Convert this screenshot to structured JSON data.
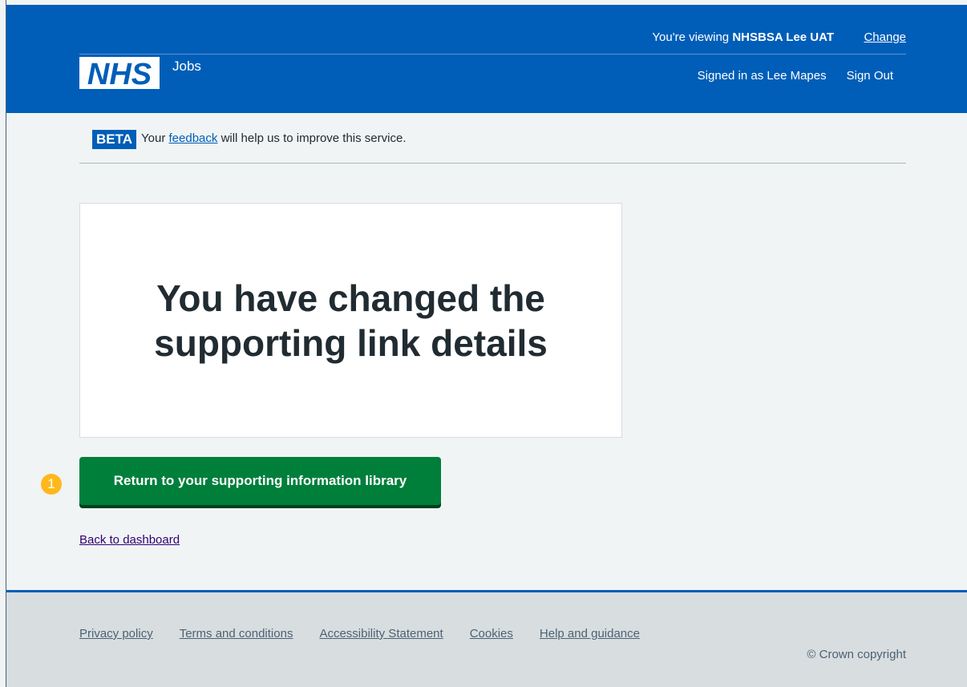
{
  "header": {
    "viewing_prefix": "You're viewing",
    "viewing_org": "NHSBSA Lee UAT",
    "change_label": "Change",
    "logo_text": "NHS",
    "service_name": "Jobs",
    "signed_in": "Signed in as Lee Mapes",
    "sign_out": "Sign Out"
  },
  "beta": {
    "tag": "BETA",
    "text_before": "Your",
    "link": "feedback",
    "text_after": "will help us to improve this service."
  },
  "panel": {
    "title": "You have changed the supporting link details"
  },
  "marker": "1",
  "primary_button": "Return to your supporting information library",
  "back_link": "Back to dashboard",
  "footer": {
    "links": [
      "Privacy policy",
      "Terms and conditions",
      "Accessibility Statement",
      "Cookies",
      "Help and guidance"
    ],
    "copyright": "© Crown copyright"
  },
  "colors": {
    "nhs_blue": "#005eb8",
    "button_green": "#007f3b",
    "marker_yellow": "#ffb81c",
    "page_bg": "#f0f4f5",
    "footer_bg": "#d8dde0"
  }
}
